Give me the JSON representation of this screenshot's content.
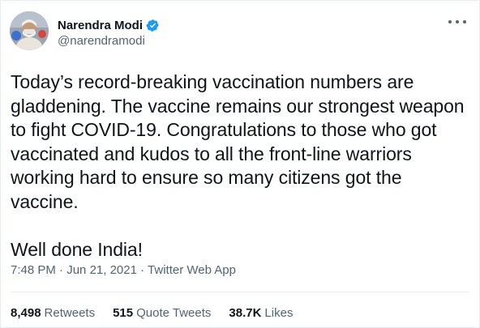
{
  "author": {
    "display_name": "Narendra Modi",
    "handle": "@narendramodi",
    "verified": true
  },
  "tweet": {
    "paragraphs": [
      "Today’s record-breaking vaccination numbers are gladdening. The vaccine remains our strongest weapon to fight COVID-19. Congratulations to those who got vaccinated and kudos to all the front-line warriors working hard to ensure so many citizens got the vaccine.",
      "Well done India!"
    ]
  },
  "meta": {
    "time": "7:48 PM",
    "date": "Jun 21, 2021",
    "source": "Twitter Web App",
    "separator": " · "
  },
  "stats": {
    "retweets_count": "8,498",
    "retweets_label": "Retweets",
    "quotes_count": "515",
    "quotes_label": "Quote Tweets",
    "likes_count": "38.7K",
    "likes_label": "Likes"
  },
  "colors": {
    "text": "#0f1419",
    "secondary": "#536471",
    "verified": "#1d9bf0",
    "border": "#e6ecf0"
  },
  "icons": [
    "verified-badge-icon",
    "more-options-icon"
  ]
}
